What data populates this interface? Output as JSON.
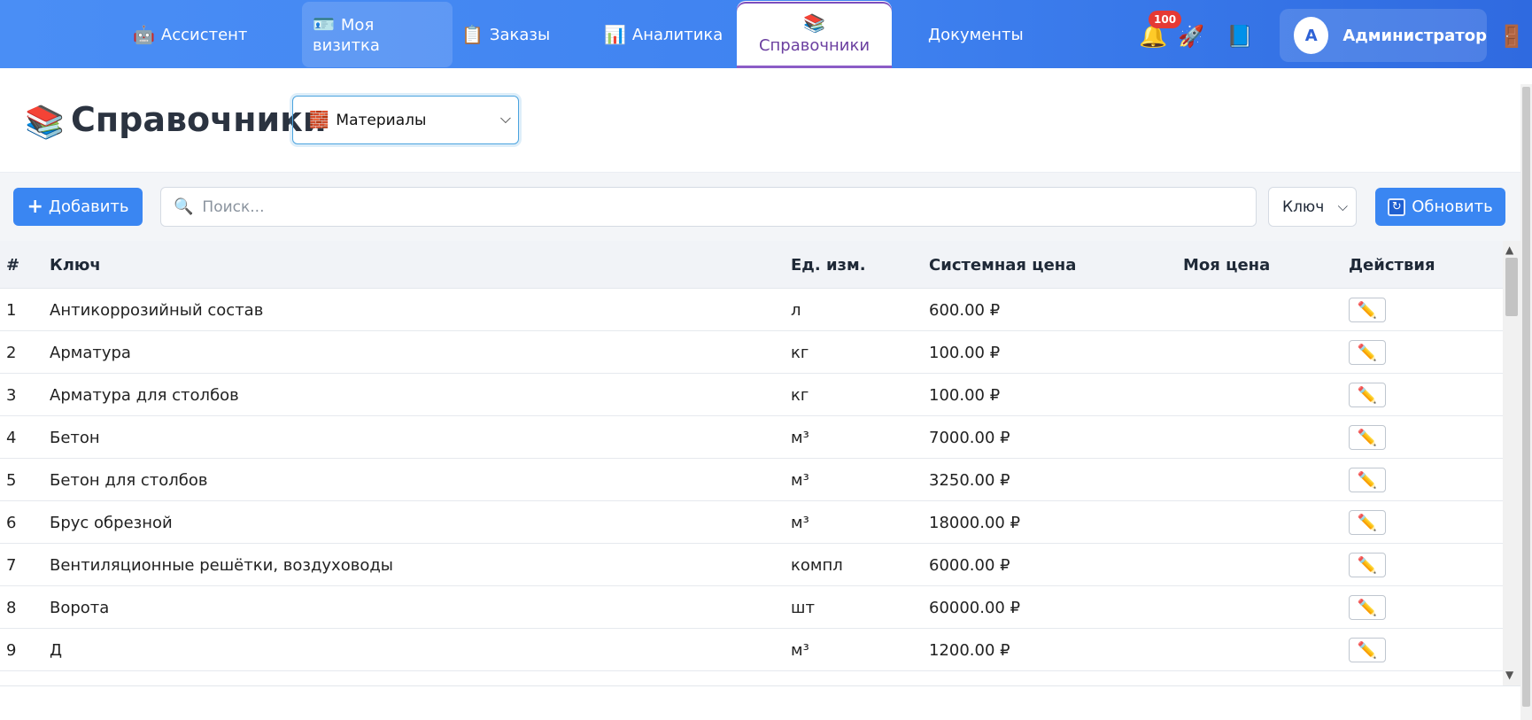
{
  "nav": {
    "assistant": {
      "icon": "🤖",
      "label": "Ассистент"
    },
    "card": {
      "icon": "🪪",
      "label_line1": "Моя",
      "label_line2": "визитка"
    },
    "orders": {
      "icon": "📋",
      "label": "Заказы"
    },
    "analytics": {
      "icon": "📊",
      "label": "Аналитика"
    },
    "references": {
      "icon": "📚",
      "label": "Справочники"
    },
    "documents": {
      "label": "Документы"
    },
    "notifications_count": "100",
    "bell_icon": "🔔",
    "rocket_icon": "🚀",
    "book_icon": "📘",
    "logout_icon": "🚪",
    "user": {
      "avatar_letter": "А",
      "name": "Администратор"
    }
  },
  "page": {
    "icon": "📚",
    "title": "Справочники",
    "directory_select": {
      "icon": "🧱",
      "value": "Материалы"
    }
  },
  "toolbar": {
    "add_label": "Добавить",
    "search_placeholder": "Поиск...",
    "sort_value": "Ключ",
    "refresh_label": "Обновить"
  },
  "table": {
    "columns": [
      "#",
      "Ключ",
      "Ед. изм.",
      "Системная цена",
      "Моя цена",
      "Действия"
    ],
    "rows": [
      {
        "num": "1",
        "key": "Антикоррозийный состав",
        "unit": "л",
        "system_price": "600.00 ₽",
        "my_price": ""
      },
      {
        "num": "2",
        "key": "Арматура",
        "unit": "кг",
        "system_price": "100.00 ₽",
        "my_price": ""
      },
      {
        "num": "3",
        "key": "Арматура для столбов",
        "unit": "кг",
        "system_price": "100.00 ₽",
        "my_price": ""
      },
      {
        "num": "4",
        "key": "Бетон",
        "unit": "м³",
        "system_price": "7000.00 ₽",
        "my_price": ""
      },
      {
        "num": "5",
        "key": "Бетон для столбов",
        "unit": "м³",
        "system_price": "3250.00 ₽",
        "my_price": ""
      },
      {
        "num": "6",
        "key": "Брус обрезной",
        "unit": "м³",
        "system_price": "18000.00 ₽",
        "my_price": ""
      },
      {
        "num": "7",
        "key": "Вентиляционные решётки, воздуховоды",
        "unit": "компл",
        "system_price": "6000.00 ₽",
        "my_price": ""
      },
      {
        "num": "8",
        "key": "Ворота",
        "unit": "шт",
        "system_price": "60000.00 ₽",
        "my_price": ""
      },
      {
        "num": "9",
        "key": "Д",
        "unit": "м³",
        "system_price": "1200.00 ₽",
        "my_price": ""
      }
    ],
    "edit_icon": "✏️"
  }
}
